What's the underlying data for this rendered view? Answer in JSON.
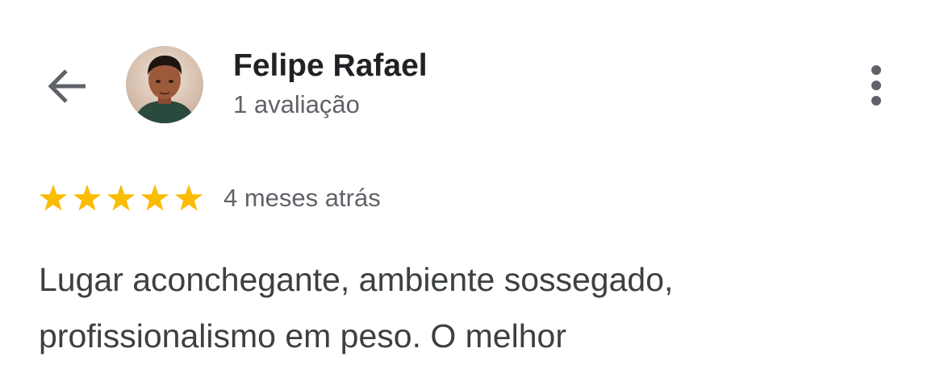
{
  "header": {
    "back_icon": "arrow-left-icon",
    "avatar_alt": "Felipe Rafael",
    "reviewer_name": "Felipe Rafael",
    "review_count": "1 avaliação",
    "more_icon": "more-vertical-icon"
  },
  "review": {
    "rating": 5,
    "rating_max": 5,
    "date": "4 meses atrás",
    "text": "Lugar aconchegante, ambiente sossegado, profissionalismo em peso. O melhor"
  },
  "colors": {
    "star": "#fbbc04",
    "primary_text": "#202124",
    "secondary_text": "#5f6368",
    "icon": "#5f6368"
  }
}
